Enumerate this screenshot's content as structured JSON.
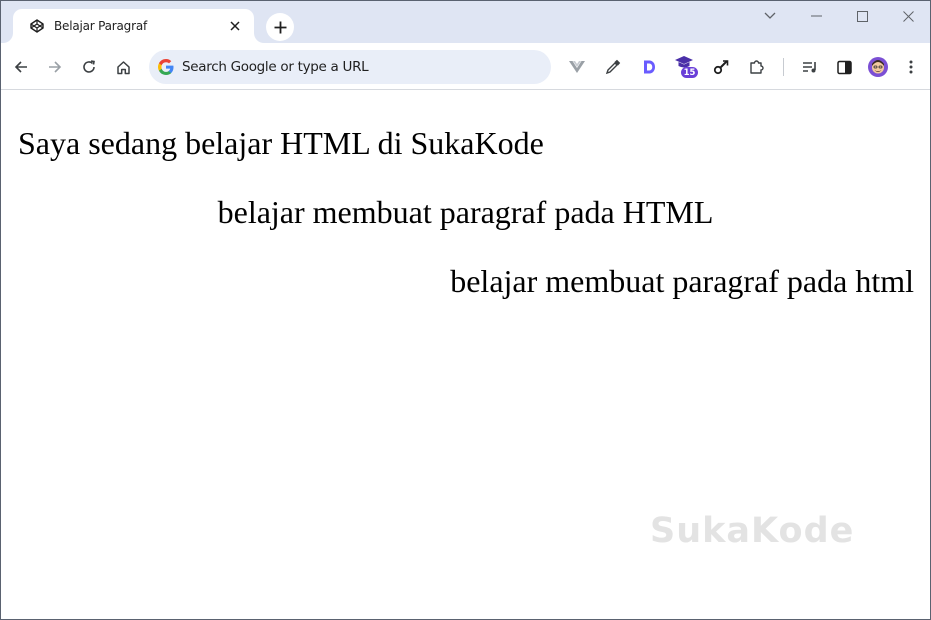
{
  "tab": {
    "title": "Belajar Paragraf",
    "favicon": "codepen-icon"
  },
  "omnibox": {
    "placeholder": "Search Google or type a URL"
  },
  "extensions": {
    "badge_count": "15"
  },
  "content": {
    "paragraphs": [
      {
        "text": "Saya sedang belajar HTML di SukaKode",
        "align": "left"
      },
      {
        "text": "belajar membuat paragraf pada HTML",
        "align": "center"
      },
      {
        "text": "belajar membuat paragraf pada html",
        "align": "right"
      }
    ],
    "watermark": "SukaKode"
  },
  "colors": {
    "tabstrip_bg": "#dfe5f3",
    "omnibox_bg": "#e9eef8",
    "extension_purple": "#6a3fd8",
    "watermark": "#e3e3e3"
  }
}
